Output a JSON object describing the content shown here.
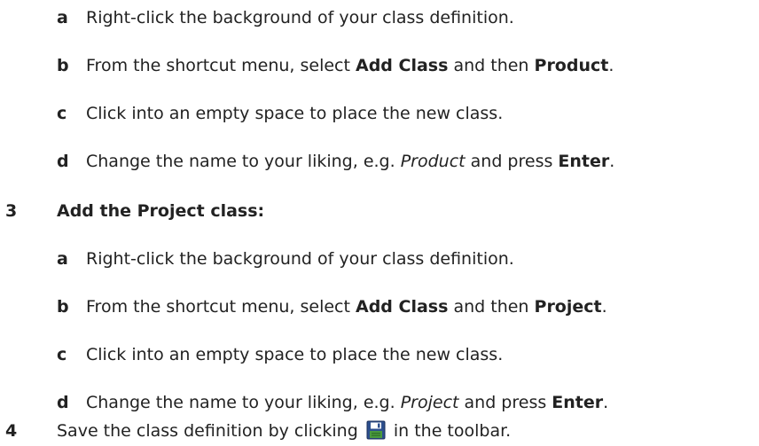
{
  "list_a": [
    {
      "letter": "a",
      "text": "Right-click the background of your class definition."
    },
    {
      "letter": "b",
      "pre": "From the shortcut menu, select ",
      "bold1": "Add Class",
      "mid": " and then ",
      "bold2": "Product",
      "post": "."
    },
    {
      "letter": "c",
      "text": "Click into an empty space to place the new class."
    },
    {
      "letter": "d",
      "pre": "Change the name to your liking, e.g. ",
      "italic": "Product",
      "mid": " and press ",
      "bold": "Enter",
      "post": "."
    }
  ],
  "step3": {
    "number": "3",
    "heading": "Add the Project class:"
  },
  "list_b": [
    {
      "letter": "a",
      "text": "Right-click the background of your class definition."
    },
    {
      "letter": "b",
      "pre": "From the shortcut menu, select ",
      "bold1": "Add Class",
      "mid": " and then ",
      "bold2": "Project",
      "post": "."
    },
    {
      "letter": "c",
      "text": "Click into an empty space to place the new class."
    },
    {
      "letter": "d",
      "pre": "Change the name to your liking, e.g. ",
      "italic": "Project",
      "mid": " and press ",
      "bold": "Enter",
      "post": "."
    }
  ],
  "step4": {
    "number": "4",
    "pre": "Save the class definition by clicking ",
    "icon": "save-icon",
    "post": " in the toolbar."
  }
}
